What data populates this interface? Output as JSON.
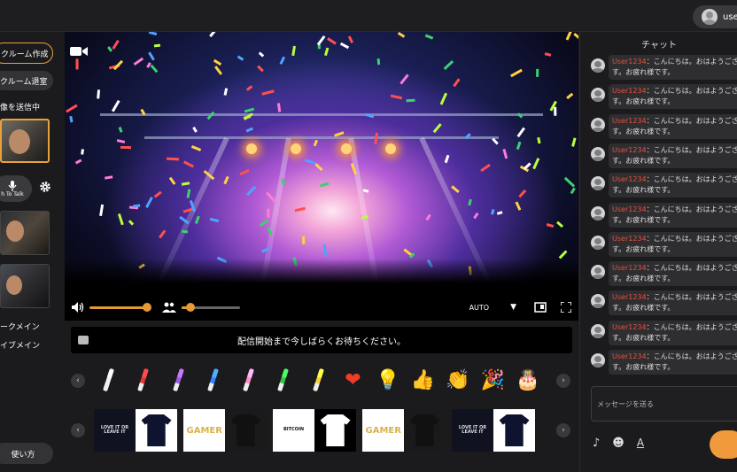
{
  "header": {
    "user_label": "user"
  },
  "sidebar": {
    "create_room": "クルーム作成",
    "leave_room": "クルーム退室",
    "send_video_label": "像を送信中",
    "push_to_talk": "h To Talk",
    "talk_main": "ークメイン",
    "live_main": "イブメイン",
    "help": "使い方"
  },
  "player": {
    "quality": "AUTO",
    "volume": 0.95,
    "mic_level": 0.15
  },
  "notice": {
    "text": "配信開始まで今しばらくお待ちください。"
  },
  "stamps": [
    {
      "icon": "white-penlight-icon",
      "color": "#f2f2f2"
    },
    {
      "icon": "red-penlight-icon",
      "color": "#e03a3a"
    },
    {
      "icon": "purple-penlight-icon",
      "color": "#9b5de5"
    },
    {
      "icon": "blue-penlight-icon",
      "color": "#3a86ff"
    },
    {
      "icon": "pink-penlight-icon",
      "color": "#ff8fc8"
    },
    {
      "icon": "green-penlight-icon",
      "color": "#3ac24b"
    },
    {
      "icon": "yellow-penlight-icon",
      "color": "#f2d53a"
    },
    {
      "icon": "heart-icon",
      "glyph": "❤"
    },
    {
      "icon": "lightbulb-icon",
      "glyph": "💡"
    },
    {
      "icon": "thumbs-up-icon",
      "glyph": "👍"
    },
    {
      "icon": "clap-icon",
      "glyph": "👏"
    },
    {
      "icon": "party-popper-icon",
      "glyph": "🎉"
    },
    {
      "icon": "cake-icon",
      "glyph": "🎂"
    }
  ],
  "shirts": [
    {
      "left_text": "LOVE IT OR LEAVE IT",
      "left_bg": "#10131f",
      "right_bg": "#ffffff",
      "tee_color": "#0e1430"
    },
    {
      "left_text": "GAMER",
      "left_bg": "#ffffff",
      "right_bg": "#1a1a1a",
      "tee_color": "#111111"
    },
    {
      "left_text": "BITCOIN",
      "left_bg": "#ffffff",
      "right_bg": "#000000",
      "tee_color": "#ffffff"
    },
    {
      "left_text": "GAMER",
      "left_bg": "#ffffff",
      "right_bg": "#1a1a1a",
      "tee_color": "#111111"
    },
    {
      "left_text": "LOVE IT OR LEAVE IT",
      "left_bg": "#10131f",
      "right_bg": "#ffffff",
      "tee_color": "#0e1430"
    }
  ],
  "chat": {
    "title": "チャット",
    "messages": [
      {
        "user": "User1234",
        "line1": "：こんにちは。おはようござ",
        "line2": "す。お疲れ様です。"
      },
      {
        "user": "User1234",
        "line1": "：こんにちは。おはようござ",
        "line2": "す。お疲れ様です。"
      },
      {
        "user": "User1234",
        "line1": "：こんにちは。おはようござ",
        "line2": "す。お疲れ様です。"
      },
      {
        "user": "User1234",
        "line1": "：こんにちは。おはようござ",
        "line2": "す。お疲れ様です。"
      },
      {
        "user": "User1234",
        "line1": "：こんにちは。おはようござ",
        "line2": "す。お疲れ様です。"
      },
      {
        "user": "User1234",
        "line1": "：こんにちは。おはようござ",
        "line2": "す。お疲れ様です。"
      },
      {
        "user": "User1234",
        "line1": "：こんにちは。おはようござ",
        "line2": "す。お疲れ様です。"
      },
      {
        "user": "User1234",
        "line1": "：こんにちは。おはようござ",
        "line2": "す。お疲れ様です。"
      },
      {
        "user": "User1234",
        "line1": "：こんにちは。おはようござ",
        "line2": "す。お疲れ様です。"
      },
      {
        "user": "User1234",
        "line1": "：こんにちは。おはようござ",
        "line2": "す。お疲れ様です。"
      },
      {
        "user": "User1234",
        "line1": "：こんにちは。おはようござ",
        "line2": "す。お疲れ様です。"
      }
    ],
    "input_placeholder": "メッセージを送る",
    "accent": "#f09a3b"
  }
}
